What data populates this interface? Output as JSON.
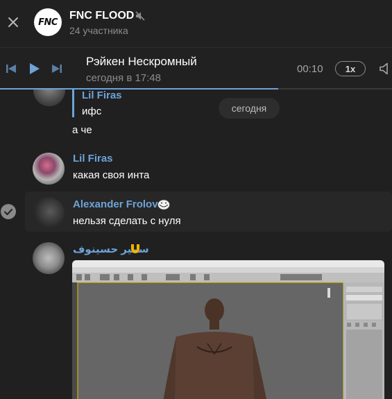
{
  "header": {
    "title": "FNC FLOOD",
    "avatar_text": "FNC",
    "subtitle": "24 участника"
  },
  "player": {
    "track_title": "Рэйкен Нескромный",
    "track_time": "сегодня в 17:48",
    "duration": "00:10",
    "speed": "1x",
    "progress": 0.71
  },
  "date_label": "сегодня",
  "messages": [
    {
      "sender": "Lil Firas",
      "text": "ифс",
      "partial": true
    },
    {
      "sender": "",
      "text": "а че"
    },
    {
      "sender": "Lil Firas",
      "text": "какая своя инта"
    },
    {
      "sender": "Alexander Frolov",
      "text": "нельзя сделать с нуля",
      "selected": true
    },
    {
      "sender": "سمير حسينوف",
      "attachment": "image"
    }
  ],
  "colors": {
    "background": "#202021",
    "accent": "#6ea3d8",
    "muted": "#8c8c8c"
  },
  "icons": [
    "close-icon",
    "mute-icon",
    "prev-icon",
    "play-icon",
    "next-icon",
    "volume-icon",
    "check-icon",
    "troll-face-emoji",
    "magnet-emoji"
  ]
}
